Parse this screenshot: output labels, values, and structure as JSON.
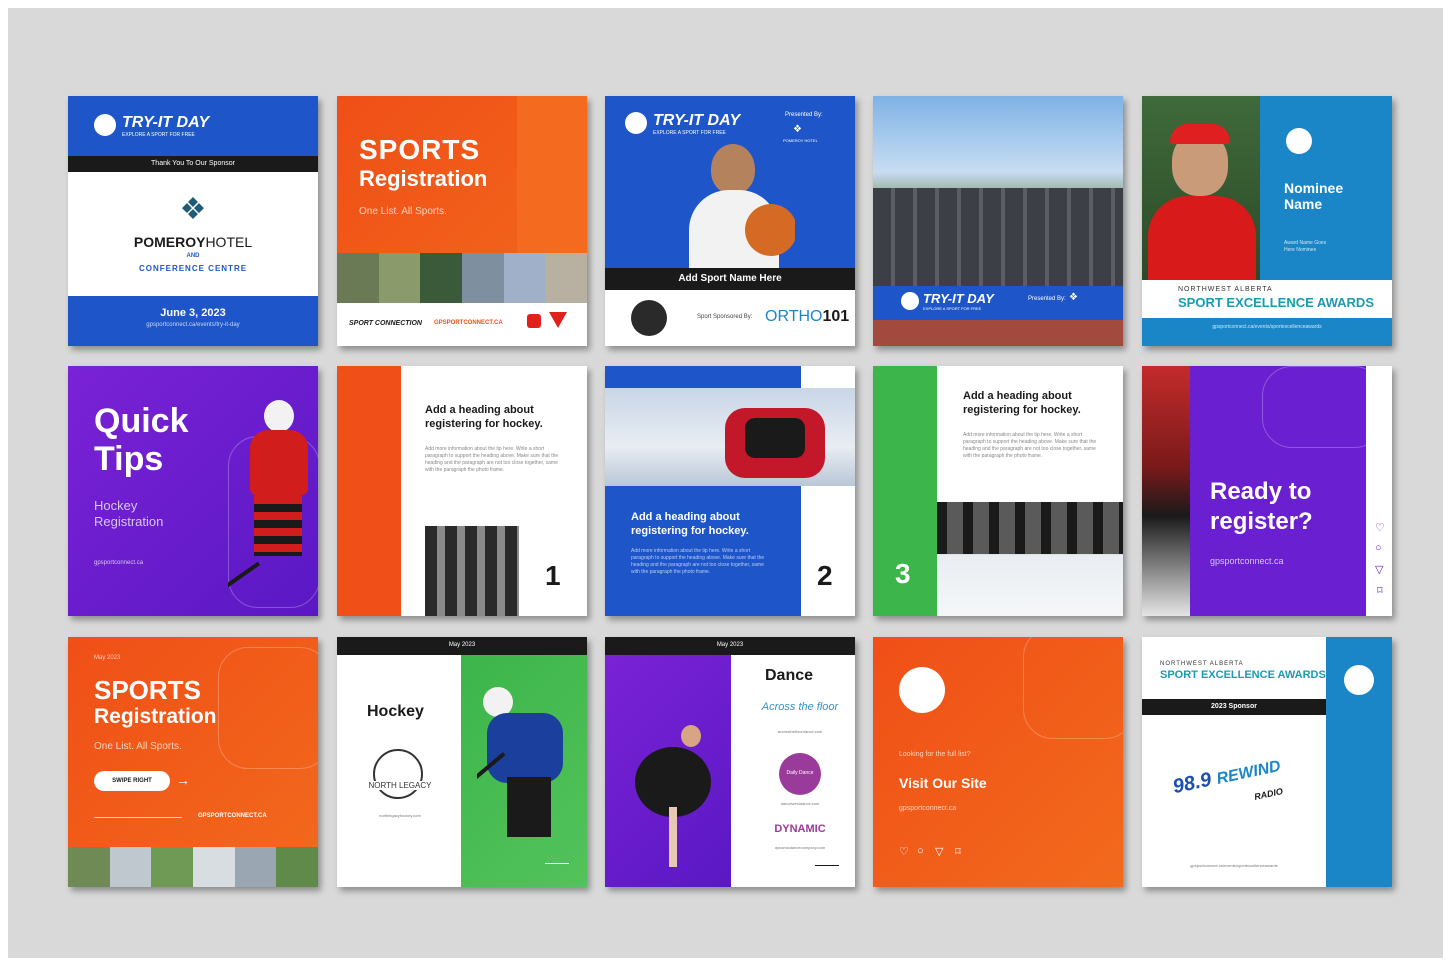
{
  "colors": {
    "blue": "#1e56c9",
    "orange": "#f04f17",
    "purple": "#6a1fd0",
    "green": "#3cb54a",
    "teal": "#1b86c7",
    "dark": "#1a1a1a"
  },
  "c1": {
    "brand": "TRY-IT DAY",
    "tagline": "EXPLORE A SPORT FOR FREE",
    "thanks": "Thank You To Our Sponsor",
    "hotel_a": "POMEROY",
    "hotel_b": "HOTEL",
    "and": "AND",
    "conf": "CONFERENCE CENTRE",
    "date": "June 3, 2023",
    "url": "gpsportconnect.ca/events/try-it-day"
  },
  "c2": {
    "title1": "SPORTS",
    "title2": "Registration",
    "sub": "One List. All Sports.",
    "brand": "SPORT CONNECTION",
    "url": "GPSPORTCONNECT.CA",
    "partner": "Canadian Tire"
  },
  "c3": {
    "brand": "TRY-IT DAY",
    "tagline": "EXPLORE A SPORT FOR FREE",
    "presented": "Presented By:",
    "hotel": "POMEROY HOTEL",
    "sport": "Add Sport Name Here",
    "sponsored": "Sport Sponsored By:",
    "sponsor": "ORTHO",
    "sponsor_num": "101"
  },
  "c4": {
    "brand": "TRY-IT DAY",
    "tagline": "EXPLORE A SPORT FOR FREE",
    "presented": "Presented By:"
  },
  "c5": {
    "nominee1": "Nominee",
    "nominee2": "Name",
    "award1": "Award Name Goes",
    "award2": "Here Nominee",
    "org": "NORTHWEST ALBERTA",
    "awards": "SPORT EXCELLENCE AWARDS",
    "url": "gpsportconnect.ca/events/sportexcellenceawards"
  },
  "c6": {
    "title1": "Quick",
    "title2": "Tips",
    "sub1": "Hockey",
    "sub2": "Registration",
    "url": "gpsportconnect.ca"
  },
  "c7": {
    "heading1": "Add a heading about",
    "heading2": "registering for hockey.",
    "para": "Add more information about the tip here. Write a short paragraph to support the heading above. Make sure that the heading and the paragraph are not too close together, same with the paragraph the photo frame.",
    "number": "1"
  },
  "c8": {
    "heading1": "Add a heading about",
    "heading2": "registering for hockey.",
    "para": "Add more information about the tip here. Write a short paragraph to support the heading above. Make sure that the heading and the paragraph are not too close together, same with the paragraph the photo frame.",
    "number": "2"
  },
  "c9": {
    "heading1": "Add a heading about",
    "heading2": "registering for hockey.",
    "para": "Add more information about the tip here. Write a short paragraph to support the heading above. Make sure that the heading and the paragraph are not too close together, same with the paragraph the photo frame.",
    "number": "3"
  },
  "c10": {
    "title1": "Ready to",
    "title2": "register?",
    "url": "gpsportconnect.ca"
  },
  "c11": {
    "date": "May 2023",
    "title1": "SPORTS",
    "title2": "Registration",
    "sub": "One List. All Sports.",
    "swipe": "SWIPE RIGHT",
    "arrow": "→",
    "url": "GPSPORTCONNECT.CA"
  },
  "c12": {
    "date": "May 2023",
    "sport": "Hockey",
    "logo": "NORTH LEGACY",
    "url": "northlegacyhockey.com"
  },
  "c13": {
    "date": "May 2023",
    "sport": "Dance",
    "logo1": "Across the floor",
    "url1": "acrossthefloordance.com",
    "logo2": "Daily Dance",
    "url2": "dancewestdance.com",
    "logo3": "DYNAMIC",
    "url3": "dynamicdancecompany.com"
  },
  "c14": {
    "line1": "Looking for the full list?",
    "title": "Visit Our Site",
    "url": "gpsportconnect.ca"
  },
  "c15": {
    "org": "NORTHWEST ALBERTA",
    "awards": "SPORT EXCELLENCE AWARDS",
    "sponsor": "2023 Sponsor",
    "station1": "98.9",
    "station2": "REWIND",
    "station3": "RADIO",
    "url": "gpsportconnect.ca/events/sportexcellenceawards"
  }
}
